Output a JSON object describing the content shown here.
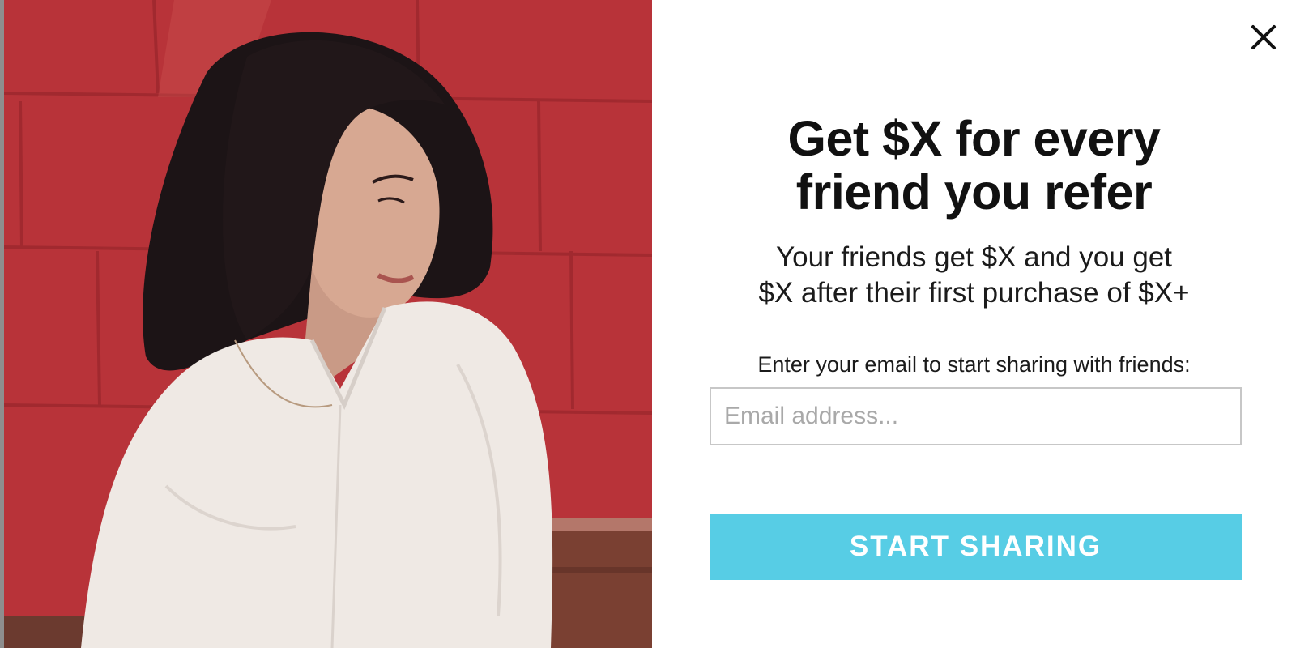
{
  "popup": {
    "headline_line1": "Get $X for every",
    "headline_line2": "friend you refer",
    "subhead_line1": "Your friends get $X and you get",
    "subhead_line2": "$X after their first purchase of $X+",
    "email_prompt": "Enter your email to start sharing with friends:",
    "email_placeholder": "Email address...",
    "email_value": "",
    "cta_label": "START SHARING",
    "close_icon": "close-icon"
  },
  "colors": {
    "accent": "#57cde5",
    "wall_red": "#b1323a",
    "text": "#111111",
    "input_border": "#c7c7c7",
    "placeholder": "#a9a9a9"
  }
}
